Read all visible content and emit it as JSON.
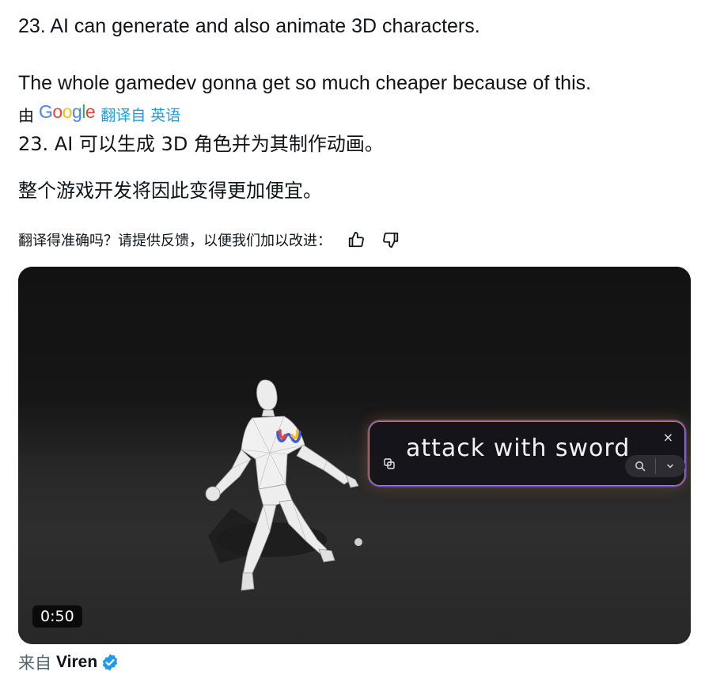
{
  "tweet": {
    "line1": "23. AI can generate and also animate 3D characters.",
    "line2": "The whole gamedev gonna get so much cheaper because of this."
  },
  "translation": {
    "by_prefix": "由",
    "provider": "Google",
    "provider_colors": [
      "#4285F4",
      "#EA4335",
      "#FBBC05",
      "#4285F4",
      "#34A853",
      "#EA4335"
    ],
    "action": "翻译自",
    "source_language": "英语",
    "line1": "23. AI 可以生成 3D 角色并为其制作动画。",
    "line2": "整个游戏开发将因此变得更加便宜。"
  },
  "feedback": {
    "question": "翻译得准确吗？请提供反馈，以便我们加以改进：",
    "thumbs_up_icon": "thumbs-up-icon",
    "thumbs_down_icon": "thumbs-down-icon"
  },
  "video": {
    "prompt_text": "attack with sword",
    "close_symbol": "×",
    "duration": "0:50",
    "accent_colors": {
      "border_purple": "#6b4fc8",
      "border_orange": "#c98a4c",
      "logo_red": "#e8473b",
      "logo_blue": "#3b5bdb",
      "logo_yellow": "#f5b82e"
    }
  },
  "source": {
    "from_label": "来自",
    "author": "Viren",
    "verified_color": "#1d9bf0"
  }
}
